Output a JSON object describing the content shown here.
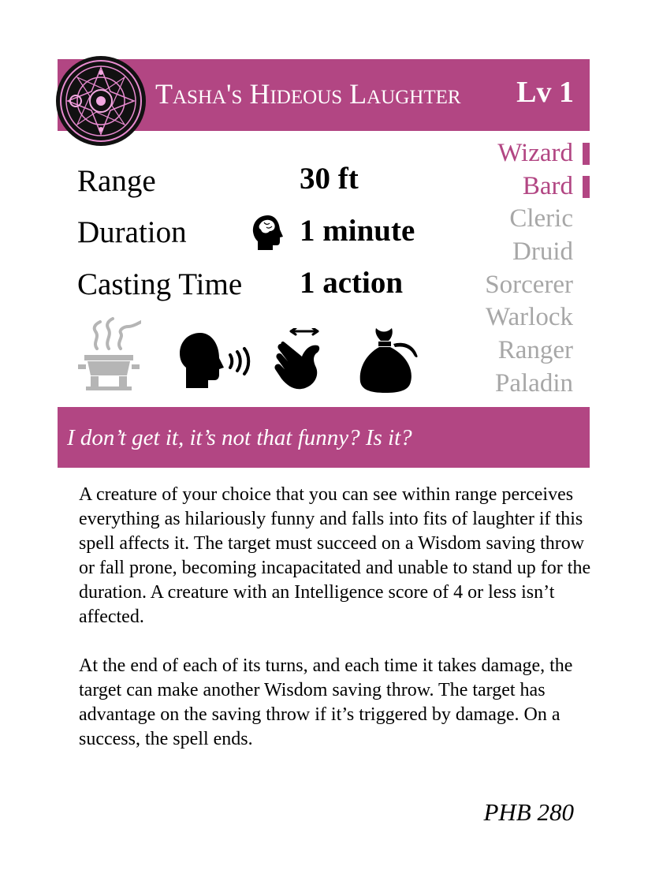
{
  "card": {
    "name": "Tasha's Hideous Laughter",
    "level": "Lv 1",
    "accent_color": "#b24683",
    "school_icon": "enchantment-school-emblem-icon"
  },
  "stats": {
    "range": {
      "label": "Range",
      "value": "30 ft"
    },
    "duration": {
      "label": "Duration",
      "value": "1 minute",
      "concentration_icon": "concentration-head-icon"
    },
    "casting_time": {
      "label": "Casting Time",
      "value": "1 action"
    }
  },
  "components": [
    {
      "icon": "ritual-brazier-icon",
      "active": false
    },
    {
      "icon": "verbal-speaking-head-icon",
      "active": true
    },
    {
      "icon": "somatic-hand-gesture-icon",
      "active": true
    },
    {
      "icon": "material-pouch-icon",
      "active": true
    }
  ],
  "classes": [
    {
      "name": "Wizard",
      "active": true
    },
    {
      "name": "Bard",
      "active": true
    },
    {
      "name": "Cleric",
      "active": false
    },
    {
      "name": "Druid",
      "active": false
    },
    {
      "name": "Sorcerer",
      "active": false
    },
    {
      "name": "Warlock",
      "active": false
    },
    {
      "name": "Ranger",
      "active": false
    },
    {
      "name": "Paladin",
      "active": false
    }
  ],
  "flavor": "I don’t get it, it’s not that funny? Is it?",
  "description": [
    "A creature of your choice that you can see within range perceives everything as hilariously funny and falls into fits of laughter if this spell affects it. The target must succeed on a Wisdom saving throw or fall prone, becoming incapacitated and unable to stand up for the duration. A creature with an Intelligence score of 4 or less isn’t affected.",
    "At the end of each of its turns, and each time it takes damage, the target can make another Wisdom saving throw. The target has advantage on the saving throw if it’s triggered by damage. On a success, the spell ends."
  ],
  "source": "PHB 280"
}
